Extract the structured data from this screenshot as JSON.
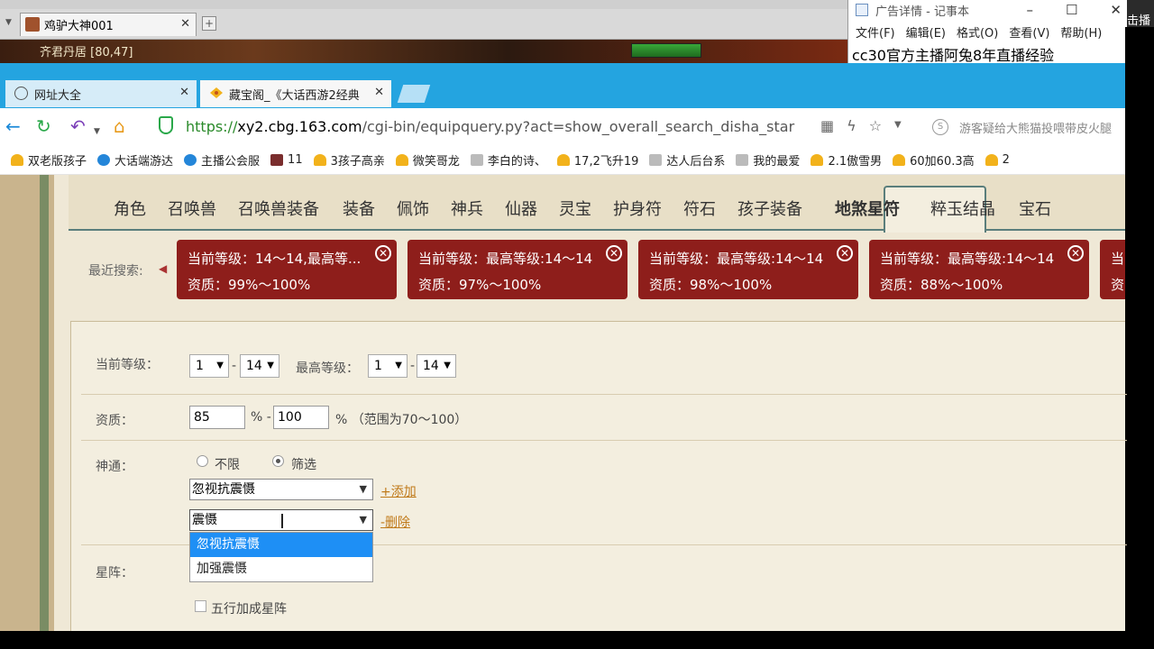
{
  "game": {
    "tab_title": "鸡驴大神001",
    "location": "齐君丹居 [80,47]"
  },
  "notepad": {
    "title": "广告详情 - 记事本",
    "menu": [
      "文件(F)",
      "编辑(E)",
      "格式(O)",
      "查看(V)",
      "帮助(H)"
    ],
    "text": "cc30官方主播阿兔8年直播经验",
    "win_min": "–",
    "win_max": "☐",
    "win_close": "✕"
  },
  "edge_text": "击播",
  "browser": {
    "tabs": [
      {
        "label": "网址大全"
      },
      {
        "label": "藏宝阁_《大话西游2经典"
      }
    ],
    "url_scheme": "https://",
    "url_domain": "xy2.cbg.163.com",
    "url_path": "/cgi-bin/equipquery.py?act=show_overall_search_disha_star",
    "search_placeholder": "游客疑给大熊猫投喂带皮火腿",
    "bookmarks": [
      {
        "label": "双老版孩子",
        "icon": "y"
      },
      {
        "label": "大话端游达",
        "icon": "b"
      },
      {
        "label": "主播公会服",
        "icon": "b"
      },
      {
        "label": "11",
        "icon": "dark"
      },
      {
        "label": "3孩子高亲",
        "icon": "y"
      },
      {
        "label": "微笑哥龙",
        "icon": "y"
      },
      {
        "label": "李白的诗、",
        "icon": "g"
      },
      {
        "label": "17,2飞升19",
        "icon": "y"
      },
      {
        "label": "达人后台系",
        "icon": "g"
      },
      {
        "label": "我的最爱",
        "icon": "g"
      },
      {
        "label": "2.1傲雪男",
        "icon": "y"
      },
      {
        "label": "60加60.3高",
        "icon": "y"
      },
      {
        "label": "2",
        "icon": "y"
      }
    ]
  },
  "categories": [
    "角色",
    "召唤兽",
    "召唤兽装备",
    "装备",
    "佩饰",
    "神兵",
    "仙器",
    "灵宝",
    "护身符",
    "符石",
    "孩子装备",
    "地煞星符",
    "粹玉结晶",
    "宝石"
  ],
  "active_category": "地煞星符",
  "recent": {
    "label": "最近搜索:",
    "cards": [
      {
        "line1": "当前等级：14～14,最高等...",
        "line2": "资质：99%～100%"
      },
      {
        "line1": "当前等级：最高等级:14～14",
        "line2": "资质：97%～100%"
      },
      {
        "line1": "当前等级：最高等级:14～14",
        "line2": "资质：98%～100%"
      },
      {
        "line1": "当前等级：最高等级:14～14",
        "line2": "资质：88%～100%"
      },
      {
        "line1": "当",
        "line2": "资"
      }
    ]
  },
  "form": {
    "level_label": "当前等级：",
    "cur_min": "1",
    "cur_max": "14",
    "dash": "-",
    "max_level_label": "最高等级：",
    "max_min": "1",
    "max_max": "14",
    "quality_label": "资质：",
    "quality_min": "85",
    "quality_max": "100",
    "percent_dash": "% -",
    "quality_hint": "% （范围为70～100）",
    "skill_label": "神通：",
    "radio_unlimited": "不限",
    "radio_filter": "筛选",
    "skill_1": "忽视抗震慑",
    "add_link": "+添加",
    "skill_2": "震慑",
    "remove_link": "-删除",
    "options": [
      "忽视抗震慑",
      "加强震慑"
    ],
    "star_label": "星阵：",
    "five_elements": "五行加成星阵"
  }
}
